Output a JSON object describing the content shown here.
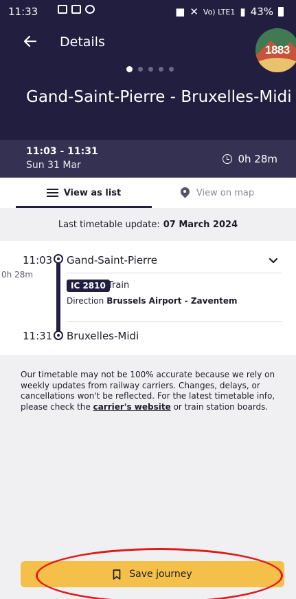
{
  "status_bar": {
    "time": "11:33",
    "net": "Vo) LTE1",
    "battery": "43%"
  },
  "header": {
    "title": "Details",
    "route": "Gand-Saint-Pierre - Bruxelles-Midi",
    "logo_text": "1883"
  },
  "carousel": {
    "count": 5,
    "active": 0
  },
  "summary": {
    "time_range": "11:03 - 11:31",
    "date": "Sun 31 Mar",
    "duration": "0h 28m"
  },
  "tabs": [
    {
      "label": "View as list"
    },
    {
      "label": "View on map"
    }
  ],
  "last_update": {
    "label": "Last timetable update:",
    "date": "07 March 2024"
  },
  "journey": {
    "departure": {
      "time": "11:03",
      "station": "Gand-Saint-Pierre"
    },
    "duration": "0h 28m",
    "train_code": "IC 2810",
    "train_type": "Train",
    "direction_label": "Direction",
    "direction": "Brussels Airport - Zaventem",
    "arrival": {
      "time": "11:31",
      "station": "Bruxelles-Midi"
    }
  },
  "disclaimer": {
    "text_1": "Our timetable may not be 100% accurate because we rely on weekly updates from railway carriers. Changes, delays, or cancellations won't be reflected. For the latest timetable info, please check the ",
    "link": "carrier's website",
    "text_2": " or train station boards."
  },
  "save_button": {
    "label": "Save journey"
  },
  "colors": {
    "header_bg": "#221e40",
    "band_bg": "#353152",
    "accent": "#f4c04a",
    "highlight": "#e11a1a"
  }
}
